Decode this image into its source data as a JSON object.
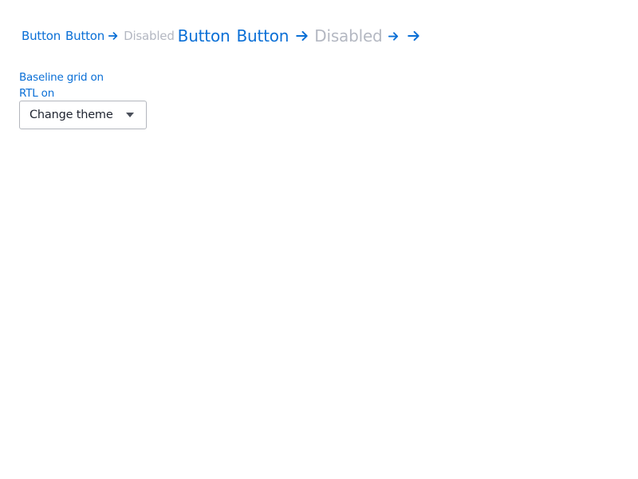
{
  "buttons_small": {
    "button_1": "Button",
    "button_2": "Button",
    "disabled": "Disabled"
  },
  "buttons_large": {
    "button_1": "Button",
    "button_2": "Button",
    "disabled": "Disabled"
  },
  "arrow_icon": "arrow-right-icon",
  "toggles": {
    "baseline_grid": "Baseline grid on",
    "rtl": "RTL on"
  },
  "theme_select": {
    "label": "Change theme",
    "icon": "caret-down-icon"
  },
  "colors": {
    "link_blue": "#0a6fd6",
    "disabled_gray": "#b4b8c2",
    "text_dark": "#1f2430",
    "border_gray": "#b3b6bd"
  }
}
